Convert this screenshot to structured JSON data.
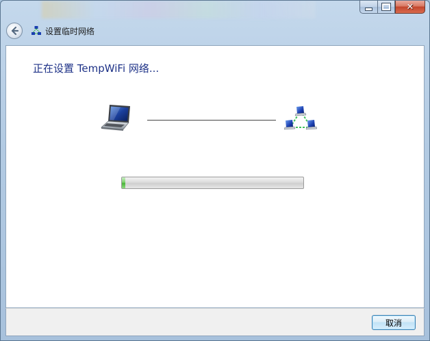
{
  "window": {
    "title": "设置临时网络",
    "title_icon": "adhoc-network-icon"
  },
  "caption": {
    "minimize_icon": "minimize-icon",
    "maximize_icon": "maximize-icon",
    "close_icon": "close-icon",
    "close_glyph": "✕"
  },
  "nav": {
    "back_icon": "back-arrow-icon"
  },
  "main": {
    "heading": "正在设置 TempWiFi 网络...",
    "left_device_icon": "laptop-icon",
    "right_device_icon": "network-icon",
    "progress": {
      "fraction": 0.02
    }
  },
  "footer": {
    "cancel_label": "取消"
  },
  "colors": {
    "heading": "#1e3287",
    "progress_fill": "#4bb43a",
    "close_button": "#c2452c"
  }
}
